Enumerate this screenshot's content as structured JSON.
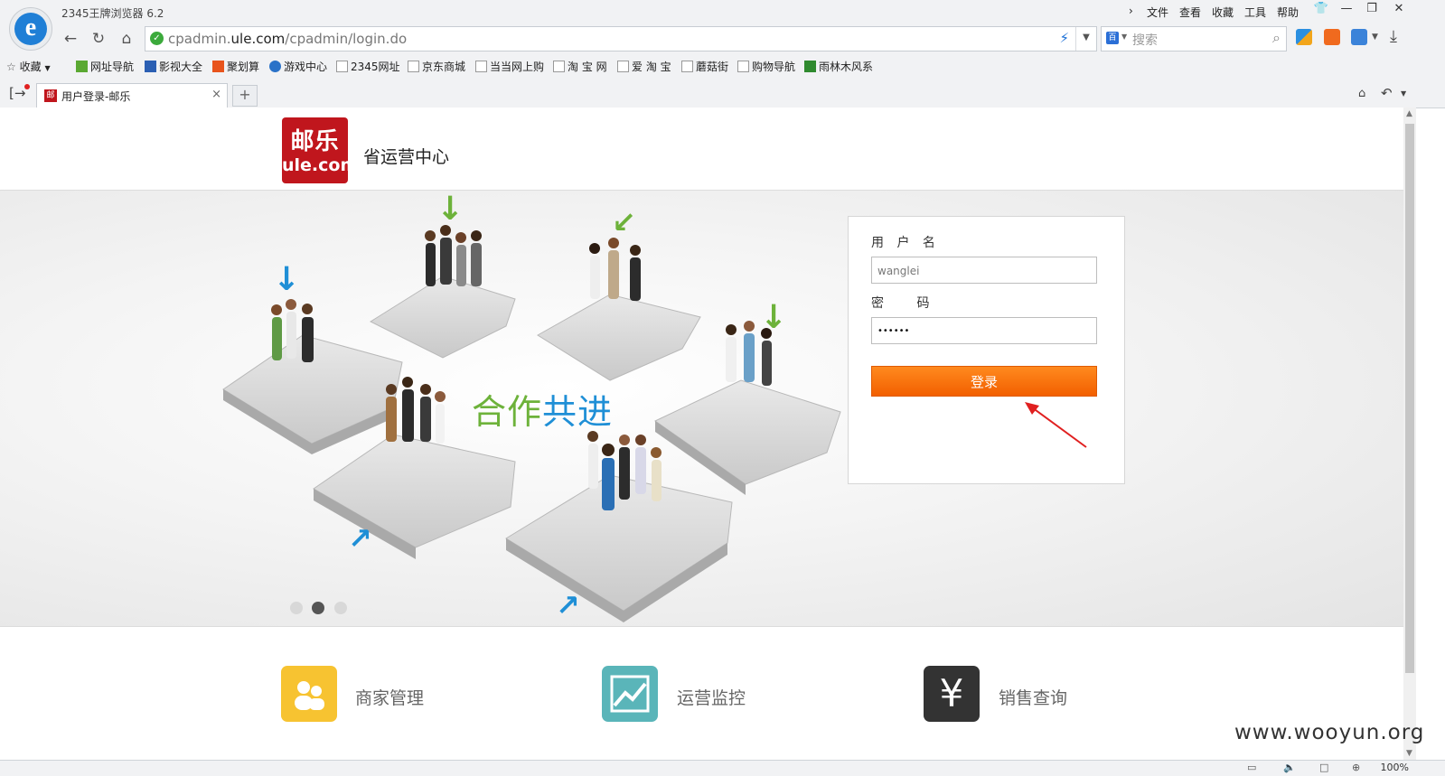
{
  "browser": {
    "app_title": "2345王牌浏览器 6.2",
    "menu": [
      "文件",
      "查看",
      "收藏",
      "工具",
      "帮助"
    ],
    "url_prefix": "cpadmin.",
    "url_domain": "ule.com",
    "url_path": "/cpadmin/login.do",
    "search_placeholder": "搜索",
    "favorites_label": "收藏",
    "bookmarks": [
      "网址导航",
      "影视大全",
      "聚划算",
      "游戏中心",
      "2345网址",
      "京东商城",
      "当当网上购",
      "淘 宝 网",
      "爱 淘 宝",
      "蘑菇街",
      "购物导航",
      "雨林木风系"
    ],
    "tab_title": "用户登录-邮乐",
    "zoom": "100%"
  },
  "header": {
    "logo_top": "邮乐",
    "logo_bottom": "ule.com",
    "title": "省运营中心"
  },
  "banner": {
    "slogan_green": "合作",
    "slogan_blue": "共进",
    "active_slide": 2,
    "slide_count": 3
  },
  "login": {
    "username_label": "用 户 名",
    "username_value": "wanglei",
    "password_label": "密  码",
    "password_value": "••••••",
    "submit_label": "登录"
  },
  "features": [
    {
      "label": "商家管理",
      "icon": "people-icon",
      "color": "#f7c331"
    },
    {
      "label": "运营监控",
      "icon": "chart-icon",
      "color": "#5ab5b9"
    },
    {
      "label": "销售查询",
      "icon": "yen-icon",
      "color": "#333333"
    }
  ],
  "watermark": "www.wooyun.org",
  "colors": {
    "brand_red": "#c0161d",
    "login_orange": "#f6720a",
    "green": "#6db23a",
    "blue": "#1f8fd6"
  }
}
